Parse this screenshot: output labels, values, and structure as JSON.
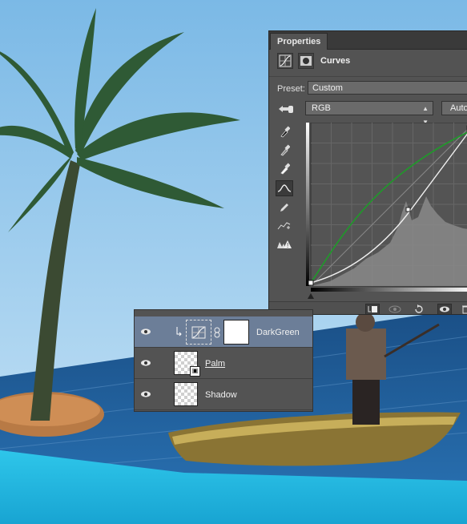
{
  "properties_panel": {
    "tab_label": "Properties",
    "adjustment_title": "Curves",
    "preset_label": "Preset:",
    "preset_value": "Custom",
    "channel_value": "RGB",
    "auto_label": "Auto"
  },
  "layers": [
    {
      "name": "DarkGreen",
      "selected": true,
      "type": "curves-adjustment",
      "clipped": true
    },
    {
      "name": "Palm",
      "selected": false,
      "type": "smart-object"
    },
    {
      "name": "Shadow",
      "selected": false,
      "type": "pixel"
    }
  ],
  "colors": {
    "sky_top": "#8cc4ea",
    "sky_bottom": "#bfe0f5",
    "panel_bg": "#535353",
    "selected_layer": "#6c7e98",
    "green_curve": "#1f9a2a",
    "ocean": "#1f5f9c",
    "lagoon": "#27b8e0"
  },
  "icons": [
    "curves-icon",
    "mask-icon",
    "hand-adjust-icon",
    "eyedropper-black-icon",
    "eyedropper-gray-icon",
    "eyedropper-white-icon",
    "curve-point-icon",
    "pencil-icon",
    "smooth-icon",
    "clipping-warning-icon",
    "clip-to-layer-icon",
    "view-previous-icon",
    "reset-icon",
    "visibility-icon",
    "delete-icon",
    "eye-icon",
    "link-icon"
  ]
}
